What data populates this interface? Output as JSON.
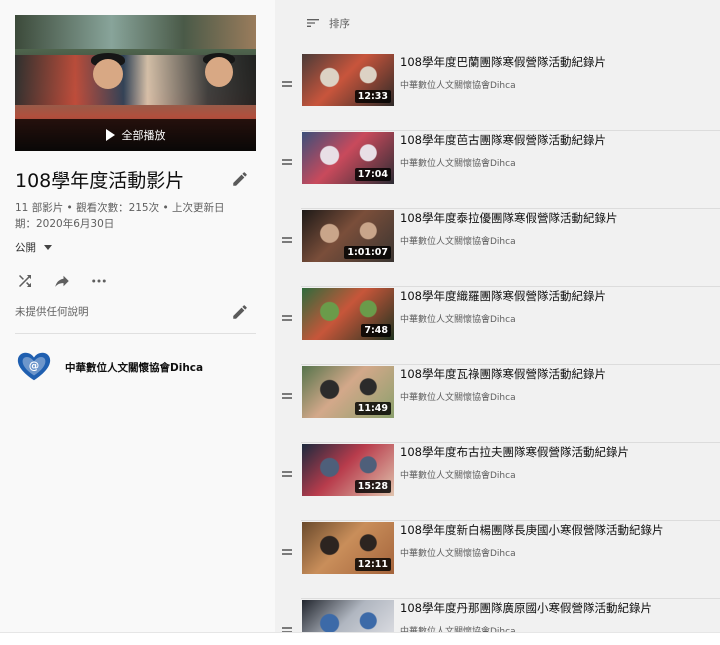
{
  "playlist": {
    "play_all_label": "全部播放",
    "title": "108學年度活動影片",
    "stats": "11 部影片 • 觀看次數：215次 • 上次更新日期：2020年6月30日",
    "privacy": "公開",
    "description": "未提供任何說明",
    "owner_name": "中華數位人文關懷協會Dihca",
    "owner_logo_text": "@"
  },
  "list": {
    "sort_label": "排序",
    "items": [
      {
        "title": "108學年度巴蘭團隊寒假營隊活動紀錄片",
        "channel": "中華數位人文關懷協會Dihca",
        "duration": "12:33"
      },
      {
        "title": "108學年度芭古團隊寒假營隊活動紀錄片",
        "channel": "中華數位人文關懷協會Dihca",
        "duration": "17:04"
      },
      {
        "title": "108學年度泰拉優團隊寒假營隊活動紀錄片",
        "channel": "中華數位人文關懷協會Dihca",
        "duration": "1:01:07"
      },
      {
        "title": "108學年度織羅團隊寒假營隊活動紀錄片",
        "channel": "中華數位人文關懷協會Dihca",
        "duration": "7:48"
      },
      {
        "title": "108學年度瓦祿團隊寒假營隊活動紀錄片",
        "channel": "中華數位人文關懷協會Dihca",
        "duration": "11:49"
      },
      {
        "title": "108學年度布古拉夫團隊寒假營隊活動紀錄片",
        "channel": "中華數位人文關懷協會Dihca",
        "duration": "15:28"
      },
      {
        "title": "108學年度新白楊團隊長庚國小寒假營隊活動紀錄片",
        "channel": "中華數位人文關懷協會Dihca",
        "duration": "12:11"
      },
      {
        "title": "108學年度丹那團隊廣原國小寒假營隊活動紀錄片",
        "channel": "中華數位人文關懷協會Dihca",
        "duration": ""
      }
    ]
  },
  "colors": {
    "logo_blue": "#1f5fb0",
    "thumbnails": [
      [
        "#4a3b38",
        "#c8553c",
        "#dcd2c4",
        "#2e2a28"
      ],
      [
        "#3b4f7a",
        "#c94a5c",
        "#e8dfe6",
        "#2c2c34"
      ],
      [
        "#1e1a18",
        "#7a4e3a",
        "#c9a58a",
        "#3a3531"
      ],
      [
        "#2f6b3c",
        "#c7563a",
        "#6a9b4a",
        "#1f3320"
      ],
      [
        "#56744c",
        "#d3a88a",
        "#2b2b2b",
        "#8aa06c"
      ],
      [
        "#1c2a3e",
        "#b83c4c",
        "#4e5f7a",
        "#e0c4ae"
      ],
      [
        "#6a4a2c",
        "#c98e5a",
        "#2c2420",
        "#a4643c"
      ],
      [
        "#22262e",
        "#b0b6c0",
        "#3c6aa8",
        "#e6e6ea"
      ]
    ]
  }
}
